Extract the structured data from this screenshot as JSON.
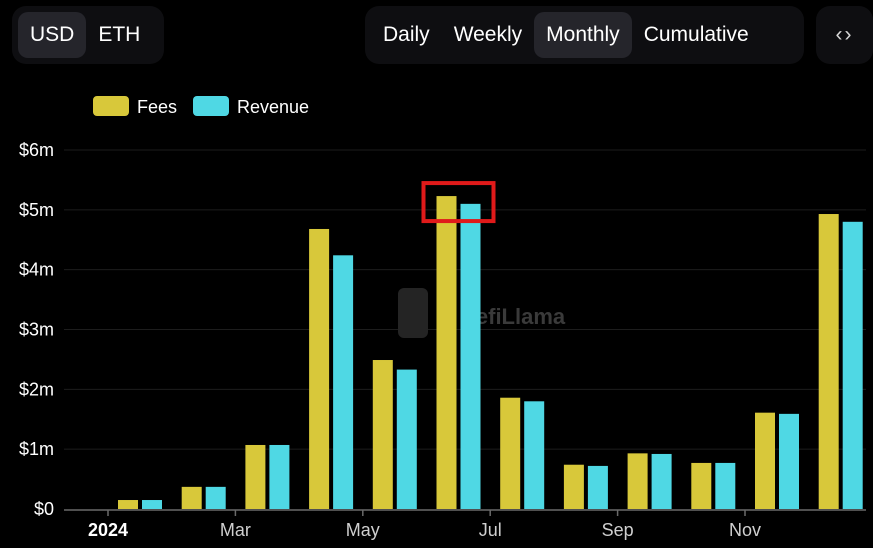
{
  "currency_toggle": {
    "options": [
      "USD",
      "ETH"
    ],
    "selected": "USD"
  },
  "period_toggle": {
    "options": [
      "Daily",
      "Weekly",
      "Monthly",
      "Cumulative"
    ],
    "selected": "Monthly"
  },
  "embed_icon": "code-brackets-icon",
  "colors": {
    "fees": "#d8c83a",
    "revenue": "#4fd8e4",
    "highlight": "#e01a1a"
  },
  "watermark": "DefiLlama",
  "chart_data": {
    "type": "bar",
    "categories": [
      "2024-01",
      "2024-02",
      "2024-03",
      "2024-04",
      "2024-05",
      "2024-06",
      "2024-07",
      "2024-08",
      "2024-09",
      "2024-10",
      "2024-11",
      "2024-12"
    ],
    "series": [
      {
        "name": "Fees",
        "values": [
          0.15,
          0.37,
          1.07,
          4.68,
          2.49,
          5.23,
          1.86,
          0.74,
          0.93,
          0.77,
          1.61,
          4.93
        ]
      },
      {
        "name": "Revenue",
        "values": [
          0.15,
          0.37,
          1.07,
          4.24,
          2.33,
          5.1,
          1.8,
          0.72,
          0.92,
          0.77,
          1.59,
          4.8
        ]
      }
    ],
    "y_unit": "USD millions",
    "ylim": [
      0,
      6
    ],
    "y_ticks": [
      "$0",
      "$1m",
      "$2m",
      "$3m",
      "$4m",
      "$5m",
      "$6m"
    ],
    "x_ticks": [
      {
        "category": "2024-01",
        "label": "2024",
        "bold": true
      },
      {
        "category": "2024-03",
        "label": "Mar"
      },
      {
        "category": "2024-05",
        "label": "May"
      },
      {
        "category": "2024-07",
        "label": "Jul"
      },
      {
        "category": "2024-09",
        "label": "Sep"
      },
      {
        "category": "2024-11",
        "label": "Nov"
      }
    ],
    "legend_position": "top-left",
    "grid": true,
    "highlighted_category": "2024-06"
  }
}
